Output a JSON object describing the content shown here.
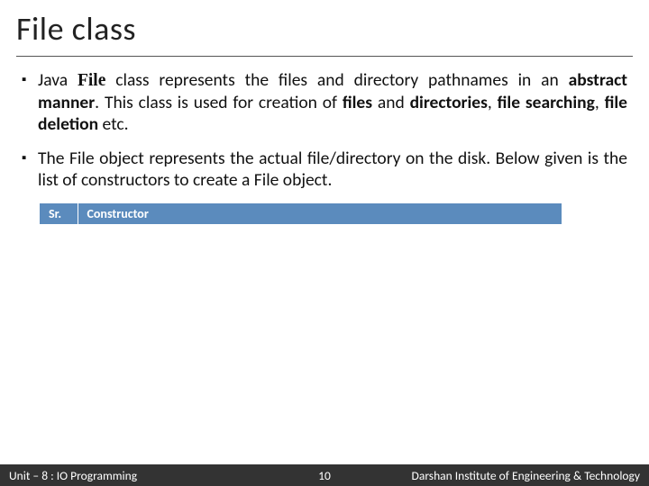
{
  "title": "File class",
  "bullets": [
    {
      "segments": [
        {
          "t": "Java ",
          "b": false,
          "serif": false
        },
        {
          "t": "File",
          "b": true,
          "serif": true
        },
        {
          "t": " class represents the files and directory pathnames in an ",
          "b": false,
          "serif": false
        },
        {
          "t": "abstract manner",
          "b": true,
          "serif": false
        },
        {
          "t": ". This class is used for creation of ",
          "b": false,
          "serif": false
        },
        {
          "t": "files",
          "b": true,
          "serif": false
        },
        {
          "t": " and ",
          "b": false,
          "serif": false
        },
        {
          "t": "directories",
          "b": true,
          "serif": false
        },
        {
          "t": ", ",
          "b": false,
          "serif": false
        },
        {
          "t": "file searching",
          "b": true,
          "serif": false
        },
        {
          "t": ", ",
          "b": false,
          "serif": false
        },
        {
          "t": "file deletion",
          "b": true,
          "serif": false
        },
        {
          "t": " etc.",
          "b": false,
          "serif": false
        }
      ]
    },
    {
      "segments": [
        {
          "t": "The File object represents the actual file/directory on the disk. Below given is the list of constructors to create a File object.",
          "b": false,
          "serif": false
        }
      ]
    }
  ],
  "table": {
    "headers": [
      "Sr.",
      "Constructor"
    ]
  },
  "footer": {
    "left": "Unit – 8 : IO Programming",
    "mid": "10",
    "right": "Darshan Institute of Engineering & Technology"
  }
}
